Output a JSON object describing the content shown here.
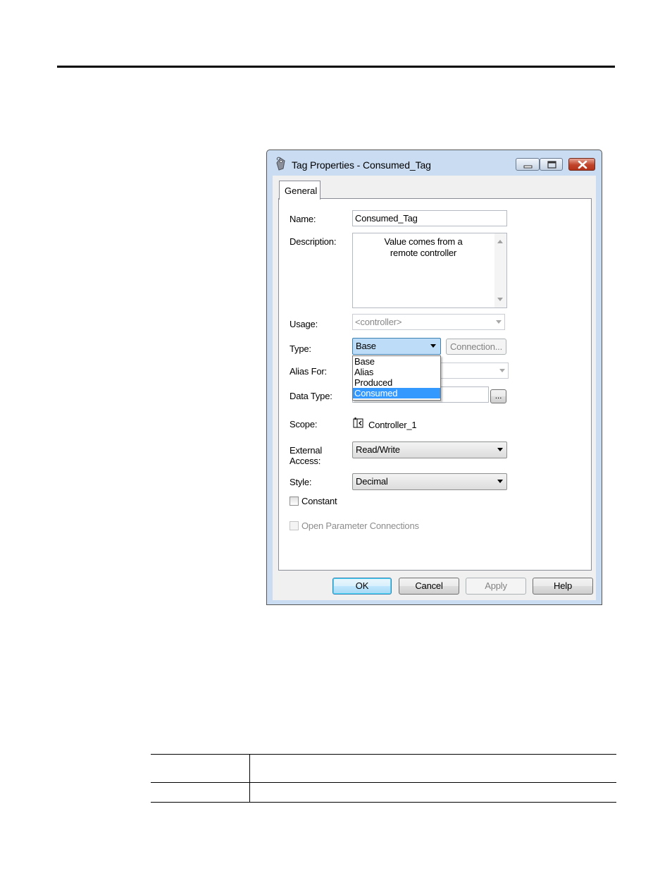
{
  "window": {
    "title": "Tag Properties - Consumed_Tag",
    "title_icon": "tag-properties-icon",
    "controls": [
      "minimize-icon",
      "maximize-icon",
      "close-icon"
    ]
  },
  "tabs": [
    {
      "label": "General",
      "active": true
    }
  ],
  "form": {
    "name_label": "Name:",
    "name_value": "Consumed_Tag",
    "description_label": "Description:",
    "description_line1": "Value comes from a",
    "description_line2": "remote controller",
    "usage_label": "Usage:",
    "usage_value": "<controller>",
    "type_label": "Type:",
    "type_value": "Base",
    "connection_button": "Connection...",
    "type_options": [
      "Base",
      "Alias",
      "Produced",
      "Consumed"
    ],
    "type_highlighted": "Consumed",
    "alias_label": "Alias For:",
    "data_type_label": "Data Type:",
    "browse_button": "...",
    "scope_label": "Scope:",
    "scope_value": "Controller_1",
    "external_access_label_1": "External",
    "external_access_label_2": "Access:",
    "external_access_value": "Read/Write",
    "style_label": "Style:",
    "style_value": "Decimal",
    "constant_label": "Constant",
    "constant_checked": false,
    "open_param_label": "Open Parameter Connections",
    "open_param_checked": false
  },
  "buttons": {
    "ok": "OK",
    "cancel": "Cancel",
    "apply": "Apply",
    "help": "Help"
  },
  "colors": {
    "selection": "#3399ff",
    "window_frame": "#c9dcf2",
    "close_button": "#c0442a"
  }
}
